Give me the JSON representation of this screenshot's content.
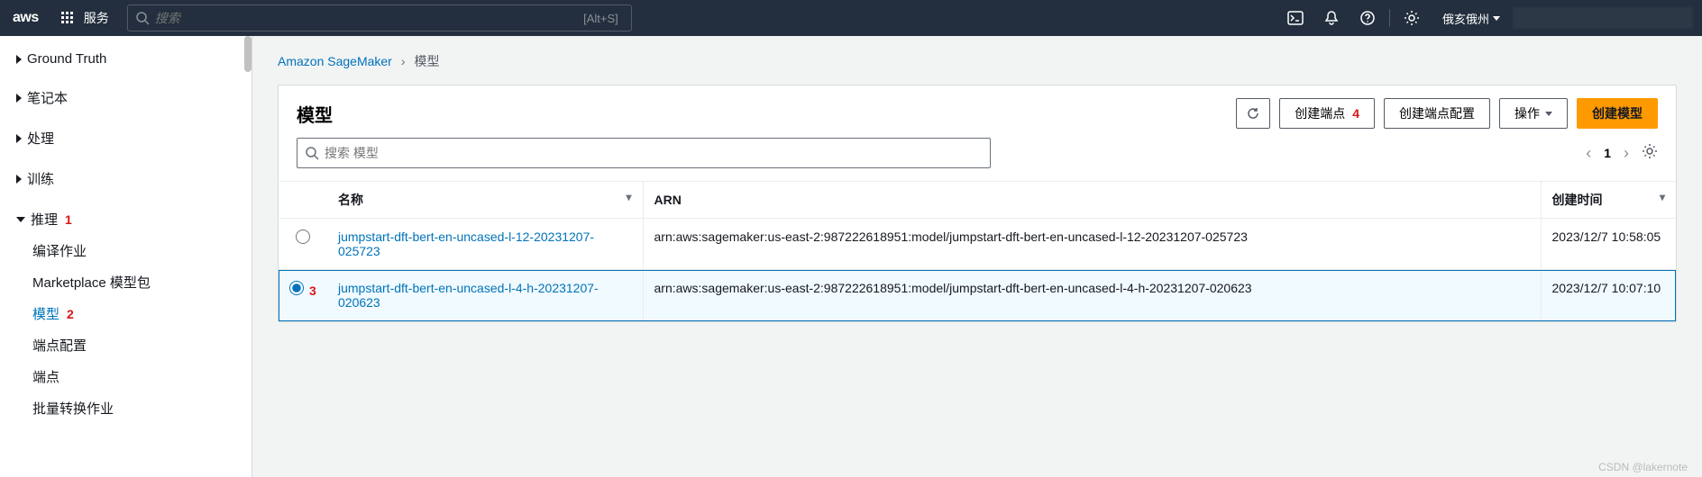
{
  "topnav": {
    "logo": "aws",
    "services_label": "服务",
    "search_placeholder": "搜索",
    "search_shortcut": "[Alt+S]",
    "region": "俄亥俄州"
  },
  "sidebar": {
    "items": [
      {
        "label": "Ground Truth",
        "type": "collapsed"
      },
      {
        "label": "笔记本",
        "type": "collapsed"
      },
      {
        "label": "处理",
        "type": "collapsed"
      },
      {
        "label": "训练",
        "type": "collapsed"
      },
      {
        "label": "推理",
        "type": "expanded",
        "annotation": "1",
        "children": [
          {
            "label": "编译作业"
          },
          {
            "label": "Marketplace 模型包"
          },
          {
            "label": "模型",
            "annotation": "2",
            "active": true
          },
          {
            "label": "端点配置"
          },
          {
            "label": "端点"
          },
          {
            "label": "批量转换作业"
          }
        ]
      }
    ]
  },
  "breadcrumb": {
    "root": "Amazon SageMaker",
    "current": "模型"
  },
  "panel": {
    "title": "模型",
    "buttons": {
      "refresh": "",
      "create_endpoint": "创建端点",
      "create_endpoint_annotation": "4",
      "create_endpoint_config": "创建端点配置",
      "actions": "操作",
      "create_model": "创建模型"
    },
    "search_placeholder": "搜索 模型",
    "page": "1"
  },
  "table": {
    "headers": {
      "name": "名称",
      "arn": "ARN",
      "created": "创建时间"
    },
    "rows": [
      {
        "selected": false,
        "name": "jumpstart-dft-bert-en-uncased-l-12-20231207-025723",
        "arn": "arn:aws:sagemaker:us-east-2:987222618951:model/jumpstart-dft-bert-en-uncased-l-12-20231207-025723",
        "created": "2023/12/7 10:58:05"
      },
      {
        "selected": true,
        "annotation": "3",
        "name": "jumpstart-dft-bert-en-uncased-l-4-h-20231207-020623",
        "arn": "arn:aws:sagemaker:us-east-2:987222618951:model/jumpstart-dft-bert-en-uncased-l-4-h-20231207-020623",
        "created": "2023/12/7 10:07:10"
      }
    ]
  },
  "watermark": "CSDN @lakernote"
}
